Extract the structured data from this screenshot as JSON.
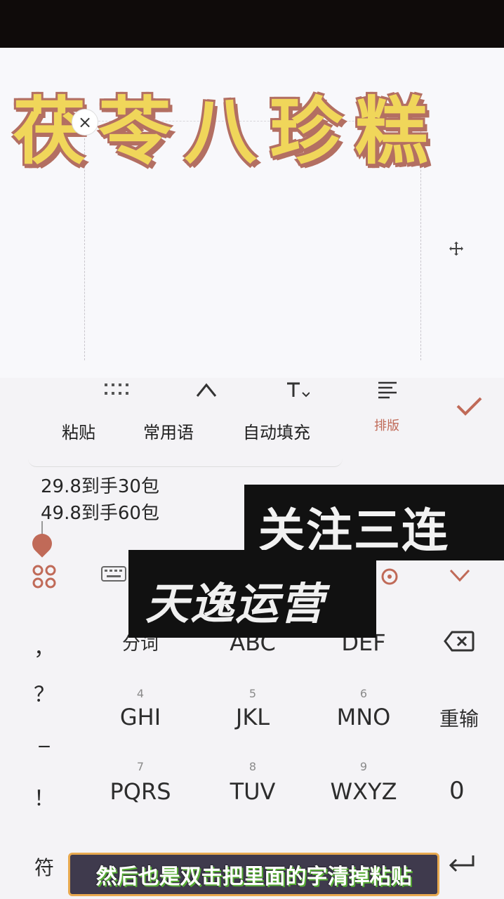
{
  "title_overlay": "茯苓八珍糕",
  "toolbar": {
    "paste_label": "粘贴",
    "phrases_label": "常用语",
    "autofill_label": "自动填充",
    "layout_label": "排版"
  },
  "clipboard": {
    "line1": "29.8到手30包",
    "line2": "49.8到手60包"
  },
  "keyboard": {
    "comma": "，",
    "question": "？",
    "dash": "_",
    "exclaim": "！",
    "symbols_label": "符",
    "segment_label": "分词",
    "abc_label": "ABC",
    "def_label": "DEF",
    "num4": "4",
    "ghi_label": "GHI",
    "num5": "5",
    "jkl_label": "JKL",
    "num6": "6",
    "mno_label": "MNO",
    "retype_label": "重输",
    "num7": "7",
    "pqrs_label": "PQRS",
    "num8": "8",
    "tuv_label": "TUV",
    "num9": "9",
    "wxyz_label": "WXYZ",
    "zero_label": "0"
  },
  "overlay": {
    "follow_text": "关注三连",
    "brand_text": "天逸运营"
  },
  "subtitle": "然后也是双击把里面的字清掉粘贴",
  "colors": {
    "accent_check": "#c06a58",
    "title_fill": "#f0d65a",
    "title_stroke": "#b36f62"
  }
}
